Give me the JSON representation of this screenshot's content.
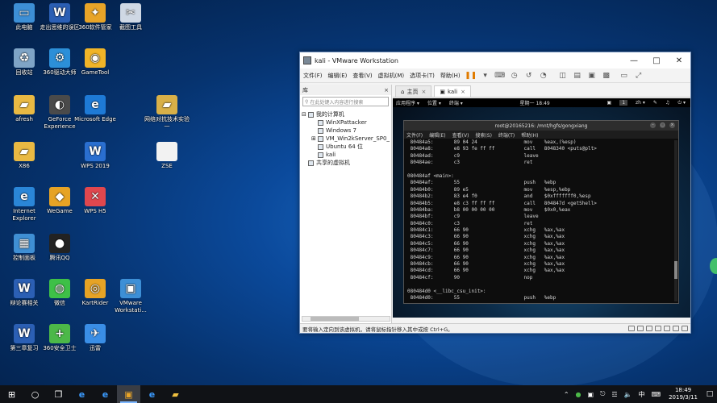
{
  "desktop_icons": [
    {
      "label": "此电脑",
      "icon": "computer-icon",
      "color": "#3d8fd6",
      "glyph": "▭"
    },
    {
      "label": "走出思维的误区",
      "icon": "word-doc-icon",
      "color": "#2b5fb4",
      "glyph": "W"
    },
    {
      "label": "360软件管家",
      "icon": "360-software-icon",
      "color": "#e8a428",
      "glyph": "✦"
    },
    {
      "label": "截图工具",
      "icon": "snipping-tool-icon",
      "color": "#cfd8e4",
      "glyph": "✂"
    },
    {
      "label": "回收站",
      "icon": "recycle-bin-icon",
      "color": "#7fa4c6",
      "glyph": "♻"
    },
    {
      "label": "360驱动大师",
      "icon": "360-driver-icon",
      "color": "#2c8fd8",
      "glyph": "⚙"
    },
    {
      "label": "GameTool",
      "icon": "gametool-icon",
      "color": "#f0b428",
      "glyph": "◉"
    },
    {
      "label": "afresh",
      "icon": "folder-icon",
      "color": "#e9b943",
      "glyph": "▰"
    },
    {
      "label": "GeForce Experience",
      "icon": "geforce-icon",
      "color": "#4a4a4a",
      "glyph": "◐"
    },
    {
      "label": "Microsoft Edge",
      "icon": "edge-icon",
      "color": "#1e7ad6",
      "glyph": "e"
    },
    {
      "label": "网络对抗技术实验一",
      "icon": "zip-folder-icon",
      "color": "#d8b048",
      "glyph": "▰"
    },
    {
      "label": "X86",
      "icon": "folder-icon",
      "color": "#e9b943",
      "glyph": "▰"
    },
    {
      "label": "WPS 2019",
      "icon": "wps-icon",
      "color": "#2a6fd0",
      "glyph": "W"
    },
    {
      "label": "ZSE",
      "icon": "file-icon",
      "color": "#f2f2f2",
      "glyph": ""
    },
    {
      "label": "Internet Explorer",
      "icon": "ie-icon",
      "color": "#2a86d8",
      "glyph": "e"
    },
    {
      "label": "WeGame",
      "icon": "wegame-icon",
      "color": "#e6a325",
      "glyph": "◆"
    },
    {
      "label": "WPS H5",
      "icon": "wps-h5-icon",
      "color": "#e0474e",
      "glyph": "✕"
    },
    {
      "label": "控制面板",
      "icon": "control-panel-icon",
      "color": "#3f8fd4",
      "glyph": "▦"
    },
    {
      "label": "腾讯QQ",
      "icon": "qq-icon",
      "color": "#222",
      "glyph": "●"
    },
    {
      "label": "辩论赛相关",
      "icon": "word-doc-icon",
      "color": "#2b5fb4",
      "glyph": "W"
    },
    {
      "label": "微信",
      "icon": "wechat-icon",
      "color": "#3ec047",
      "glyph": "◍"
    },
    {
      "label": "KartRider",
      "icon": "kartrider-icon",
      "color": "#e6a325",
      "glyph": "◎"
    },
    {
      "label": "VMware Workstati...",
      "icon": "vmware-icon",
      "color": "#3d8fd6",
      "glyph": "▣"
    },
    {
      "label": "第三章复习",
      "icon": "word-doc-icon",
      "color": "#2b5fb4",
      "glyph": "W"
    },
    {
      "label": "360安全卫士",
      "icon": "360-security-icon",
      "color": "#4cb848",
      "glyph": "+"
    },
    {
      "label": "迅雷",
      "icon": "xunlei-icon",
      "color": "#3a8ee6",
      "glyph": "✈"
    }
  ],
  "vmware": {
    "title": "kali - VMware Workstation",
    "menu": [
      "文件(F)",
      "编辑(E)",
      "查看(V)",
      "虚拟机(M)",
      "选项卡(T)",
      "帮助(H)"
    ],
    "library": {
      "header": "库",
      "close": "×",
      "search_placeholder": "在此处键入内容进行搜索",
      "tree": [
        {
          "label": "我的计算机",
          "indent": 0,
          "prefix": "⊟"
        },
        {
          "label": "WinXPattacker",
          "indent": 1,
          "prefix": ""
        },
        {
          "label": "Windows 7",
          "indent": 1,
          "prefix": ""
        },
        {
          "label": "VM_Win2kServer_SP0_",
          "indent": 1,
          "prefix": "⊞"
        },
        {
          "label": "Ubuntu 64 位",
          "indent": 1,
          "prefix": ""
        },
        {
          "label": "kali",
          "indent": 1,
          "prefix": ""
        },
        {
          "label": "共享的虚拟机",
          "indent": 0,
          "prefix": ""
        }
      ]
    },
    "tabs": [
      {
        "label": "主页",
        "active": false
      },
      {
        "label": "kali",
        "active": true
      }
    ],
    "status_text": "要将输入定向到该虚拟机，请将鼠标指针移入其中或按 Ctrl+G。"
  },
  "guest": {
    "topbar": {
      "apps": "应用程序 ▾",
      "places": "位置 ▾",
      "terminal": "终端 ▾",
      "clock": "星期一 18:49",
      "workspace": "1",
      "lang": "zh ▾"
    },
    "terminal": {
      "title": "root@20165216: /mnt/hgfs/gongxiang",
      "menu": [
        "文件(F)",
        "编辑(E)",
        "查看(V)",
        "搜索(S)",
        "终端(T)",
        "帮助(H)"
      ],
      "lines": [
        " 80484a5:       89 04 24                mov    %eax,(%esp)",
        " 80484a8:       e8 93 fe ff ff          call   8048340 <puts@plt>",
        " 80484ad:       c9                      leave",
        " 80484ae:       c3                      ret",
        "",
        "080484af <main>:",
        " 80484af:       55                      push   %ebp",
        " 80484b0:       89 e5                   mov    %esp,%ebp",
        " 80484b2:       83 e4 f0                and    $0xfffffff0,%esp",
        " 80484b5:       e8 c3 ff ff ff          call   804847d <getShell>",
        " 80484ba:       b8 00 00 00 00          mov    $0x0,%eax",
        " 80484bf:       c9                      leave",
        " 80484c0:       c3                      ret",
        " 80484c1:       66 90                   xchg   %ax,%ax",
        " 80484c3:       66 90                   xchg   %ax,%ax",
        " 80484c5:       66 90                   xchg   %ax,%ax",
        " 80484c7:       66 90                   xchg   %ax,%ax",
        " 80484c9:       66 90                   xchg   %ax,%ax",
        " 80484cb:       66 90                   xchg   %ax,%ax",
        " 80484cd:       66 90                   xchg   %ax,%ax",
        " 80484cf:       90                      nop",
        "",
        "080484d0 <__libc_csu_init>:",
        " 80484d0:       55                      push   %ebp"
      ]
    }
  },
  "taskbar": {
    "ime": "中",
    "time": "18:49",
    "date": "2019/3/11"
  }
}
